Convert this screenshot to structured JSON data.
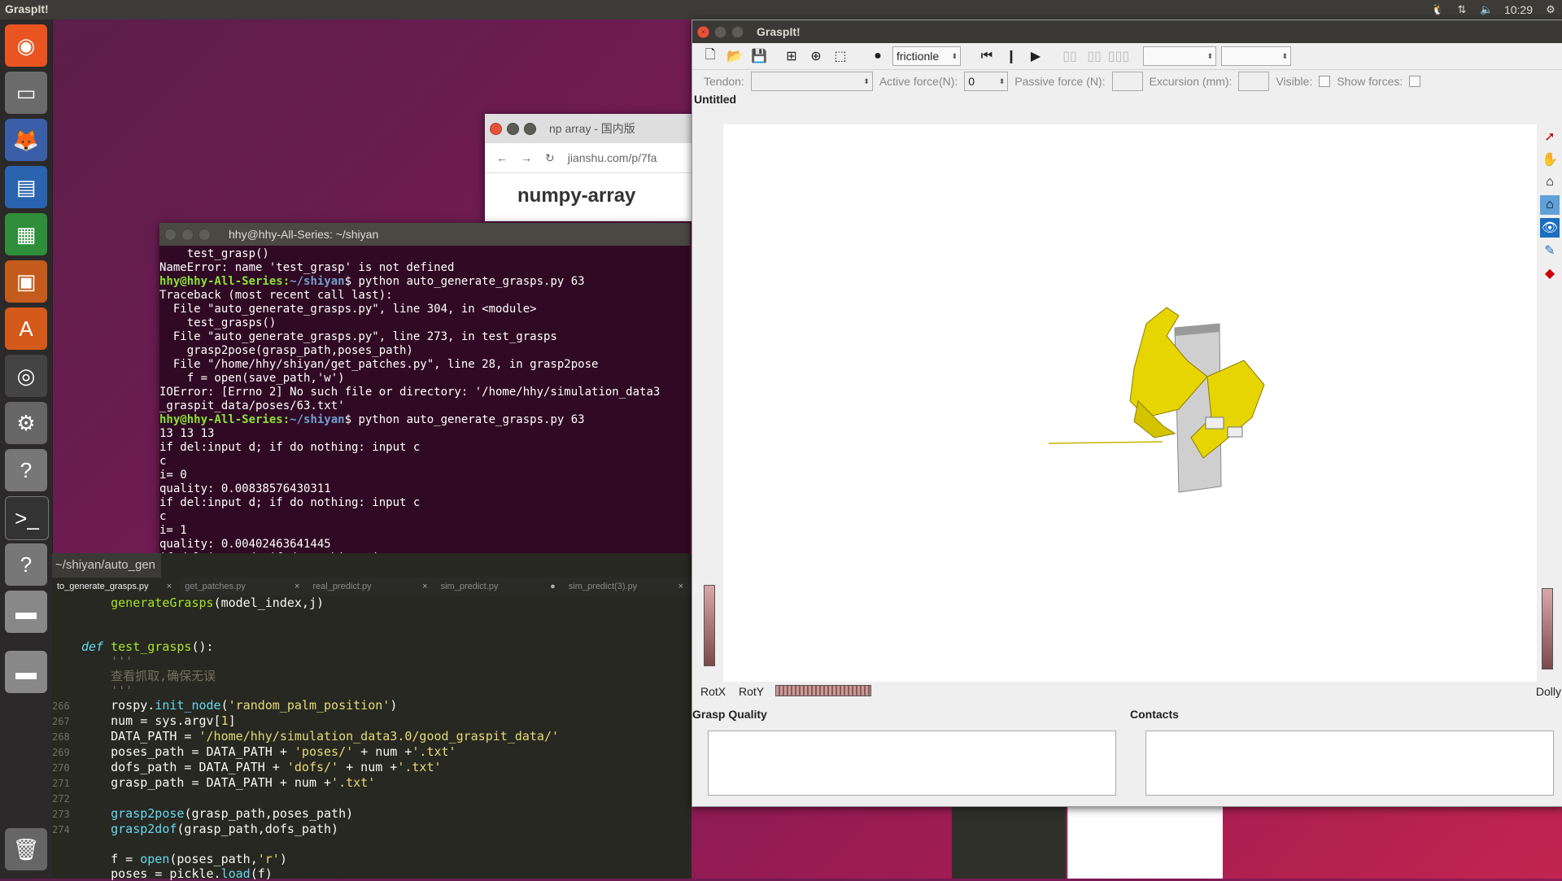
{
  "top_panel": {
    "app_name": "GraspIt!",
    "clock": "10:29"
  },
  "launcher": {
    "items": [
      "ubuntu-dash",
      "files",
      "firefox",
      "writer",
      "calc",
      "impress",
      "software-center",
      "chrome",
      "settings",
      "unknown-app",
      "terminal",
      "unknown-app",
      "drive",
      "drive",
      "trash"
    ]
  },
  "browser": {
    "tab_title": "np array - 国内版",
    "url": "jianshu.com/p/7fa",
    "heading": "numpy-array"
  },
  "terminal": {
    "title": "hhy@hhy-All-Series: ~/shiyan",
    "lines": [
      {
        "t": "    test_grasp()"
      },
      {
        "t": "NameError: name 'test_grasp' is not defined"
      },
      {
        "prompt": "hhy@hhy-All-Series",
        "cwd": "~/shiyan",
        "t": "$ python auto_generate_grasps.py 63"
      },
      {
        "t": "Traceback (most recent call last):"
      },
      {
        "t": "  File \"auto_generate_grasps.py\", line 304, in <module>"
      },
      {
        "t": "    test_grasps()"
      },
      {
        "t": "  File \"auto_generate_grasps.py\", line 273, in test_grasps"
      },
      {
        "t": "    grasp2pose(grasp_path,poses_path)"
      },
      {
        "t": "  File \"/home/hhy/shiyan/get_patches.py\", line 28, in grasp2pose"
      },
      {
        "t": "    f = open(save_path,'w')"
      },
      {
        "t": "IOError: [Errno 2] No such file or directory: '/home/hhy/simulation_data3"
      },
      {
        "t": "_graspit_data/poses/63.txt'"
      },
      {
        "prompt": "hhy@hhy-All-Series",
        "cwd": "~/shiyan",
        "t": "$ python auto_generate_grasps.py 63"
      },
      {
        "t": "13 13 13"
      },
      {
        "t": "if del:input d; if do nothing: input c"
      },
      {
        "t": "c"
      },
      {
        "t": "i= 0"
      },
      {
        "t": "quality: 0.00838576430311"
      },
      {
        "t": "if del:input d; if do nothing: input c"
      },
      {
        "t": "c"
      },
      {
        "t": "i= 1"
      },
      {
        "t": "quality: 0.00402463641445"
      },
      {
        "t": "if del:input d; if do nothing: input c"
      }
    ]
  },
  "editor": {
    "path": "~/shiyan/auto_gen",
    "tabs": [
      "to_generate_grasps.py",
      "get_patches.py",
      "real_predict.py",
      "sim_predict.py",
      "sim_predict(3).py"
    ],
    "code": [
      {
        "n": "",
        "html": "    <span class='fn'>generateGrasps</span>(model_index,j)"
      },
      {
        "n": "",
        "html": ""
      },
      {
        "n": "",
        "html": ""
      },
      {
        "n": "",
        "html": "<span class='kw'>def</span> <span class='fn'>test_grasps</span>():"
      },
      {
        "n": "",
        "html": "    <span class='cm'>'''</span>"
      },
      {
        "n": "",
        "html": "    <span class='cm'>查看抓取,确保无误</span>"
      },
      {
        "n": "",
        "html": "    <span class='cm'>'''</span>"
      },
      {
        "n": "266",
        "html": "    rospy.<span class='bi'>init_node</span>(<span class='str'>'random_palm_position'</span>)"
      },
      {
        "n": "267",
        "html": "    num = sys.argv[<span class='str'>1</span>]"
      },
      {
        "n": "268",
        "html": "    DATA_PATH = <span class='str'>'/home/hhy/simulation_data3.0/good_graspit_data/'</span>"
      },
      {
        "n": "269",
        "html": "    poses_path = DATA_PATH + <span class='str'>'poses/'</span> + num +<span class='str'>'.txt'</span>"
      },
      {
        "n": "270",
        "html": "    dofs_path = DATA_PATH + <span class='str'>'dofs/'</span> + num +<span class='str'>'.txt'</span>"
      },
      {
        "n": "271",
        "html": "    grasp_path = DATA_PATH + num +<span class='str'>'.txt'</span>"
      },
      {
        "n": "272",
        "html": ""
      },
      {
        "n": "273",
        "html": "    <span class='bi'>grasp2pose</span>(grasp_path,poses_path)"
      },
      {
        "n": "274",
        "html": "    <span class='bi'>grasp2dof</span>(grasp_path,dofs_path)"
      },
      {
        "n": "",
        "html": ""
      },
      {
        "n": "",
        "html": "    f = <span class='bi'>open</span>(poses_path,<span class='str'>'r'</span>)"
      },
      {
        "n": "",
        "html": "    poses = pickle.<span class='bi'>load</span>(f)"
      }
    ]
  },
  "graspit": {
    "title": "GraspIt!",
    "friction_combo": "frictionle",
    "tendon_label": "Tendon:",
    "active_force_label": "Active force(N):",
    "active_force_value": "0",
    "passive_force_label": "Passive force (N):",
    "excursion_label": "Excursion (mm):",
    "visible_label": "Visible:",
    "show_forces_label": "Show forces:",
    "doc_title": "Untitled",
    "rotx": "RotX",
    "roty": "RotY",
    "dolly": "Dolly",
    "grasp_quality_label": "Grasp Quality",
    "contacts_label": "Contacts"
  }
}
